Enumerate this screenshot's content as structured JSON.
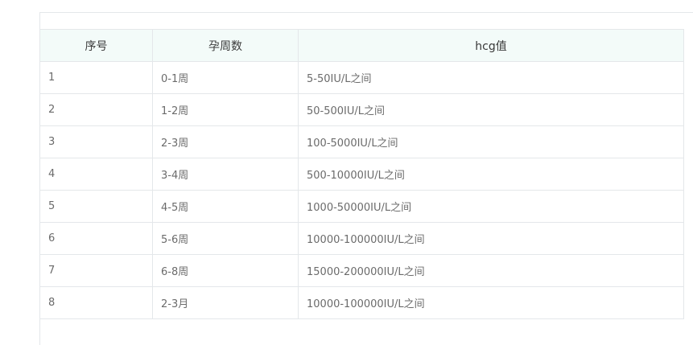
{
  "table": {
    "headers": [
      "序号",
      "孕周数",
      "hcg值"
    ],
    "rows": [
      {
        "no": "1",
        "week": "0-1周",
        "hcg": "5-50IU/L之间"
      },
      {
        "no": "2",
        "week": "1-2周",
        "hcg": "50-500IU/L之间"
      },
      {
        "no": "3",
        "week": "2-3周",
        "hcg": "100-5000IU/L之间"
      },
      {
        "no": "4",
        "week": "3-4周",
        "hcg": "500-10000IU/L之间"
      },
      {
        "no": "5",
        "week": "4-5周",
        "hcg": "1000-50000IU/L之间"
      },
      {
        "no": "6",
        "week": "5-6周",
        "hcg": "10000-100000IU/L之间"
      },
      {
        "no": "7",
        "week": "6-8周",
        "hcg": "15000-200000IU/L之间"
      },
      {
        "no": "8",
        "week": "2-3月",
        "hcg": "10000-100000IU/L之间"
      }
    ]
  }
}
